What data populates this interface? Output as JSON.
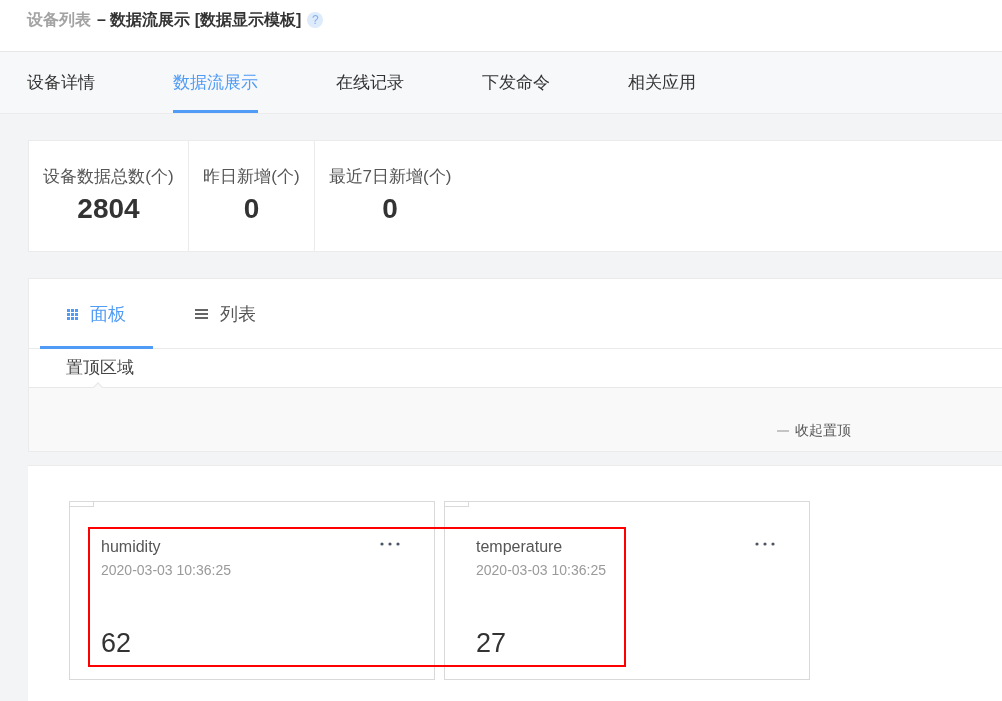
{
  "header": {
    "breadcrumb": "设备列表",
    "title": "– 数据流展示 [数据显示模板]",
    "help": "?"
  },
  "tabs": [
    {
      "label": "设备详情",
      "selected": false
    },
    {
      "label": "数据流展示",
      "selected": true
    },
    {
      "label": "在线记录",
      "selected": false
    },
    {
      "label": "下发命令",
      "selected": false
    },
    {
      "label": "相关应用",
      "selected": false
    }
  ],
  "stats": [
    {
      "label": "设备数据总数(个)",
      "value": "2804"
    },
    {
      "label": "昨日新增(个)",
      "value": "0"
    },
    {
      "label": "最近7日新增(个)",
      "value": "0"
    }
  ],
  "view_tabs": [
    {
      "label": "面板",
      "kind": "grid",
      "selected": true
    },
    {
      "label": "列表",
      "kind": "list",
      "selected": false
    }
  ],
  "pinned": {
    "label": "置顶区域",
    "collapse_label": "收起置顶"
  },
  "datastreams": [
    {
      "name": "humidity",
      "time": "2020-03-03 10:36:25",
      "value": "62"
    },
    {
      "name": "temperature",
      "time": "2020-03-03 10:36:25",
      "value": "27"
    }
  ],
  "annotation": {
    "kind": "rectangle"
  }
}
